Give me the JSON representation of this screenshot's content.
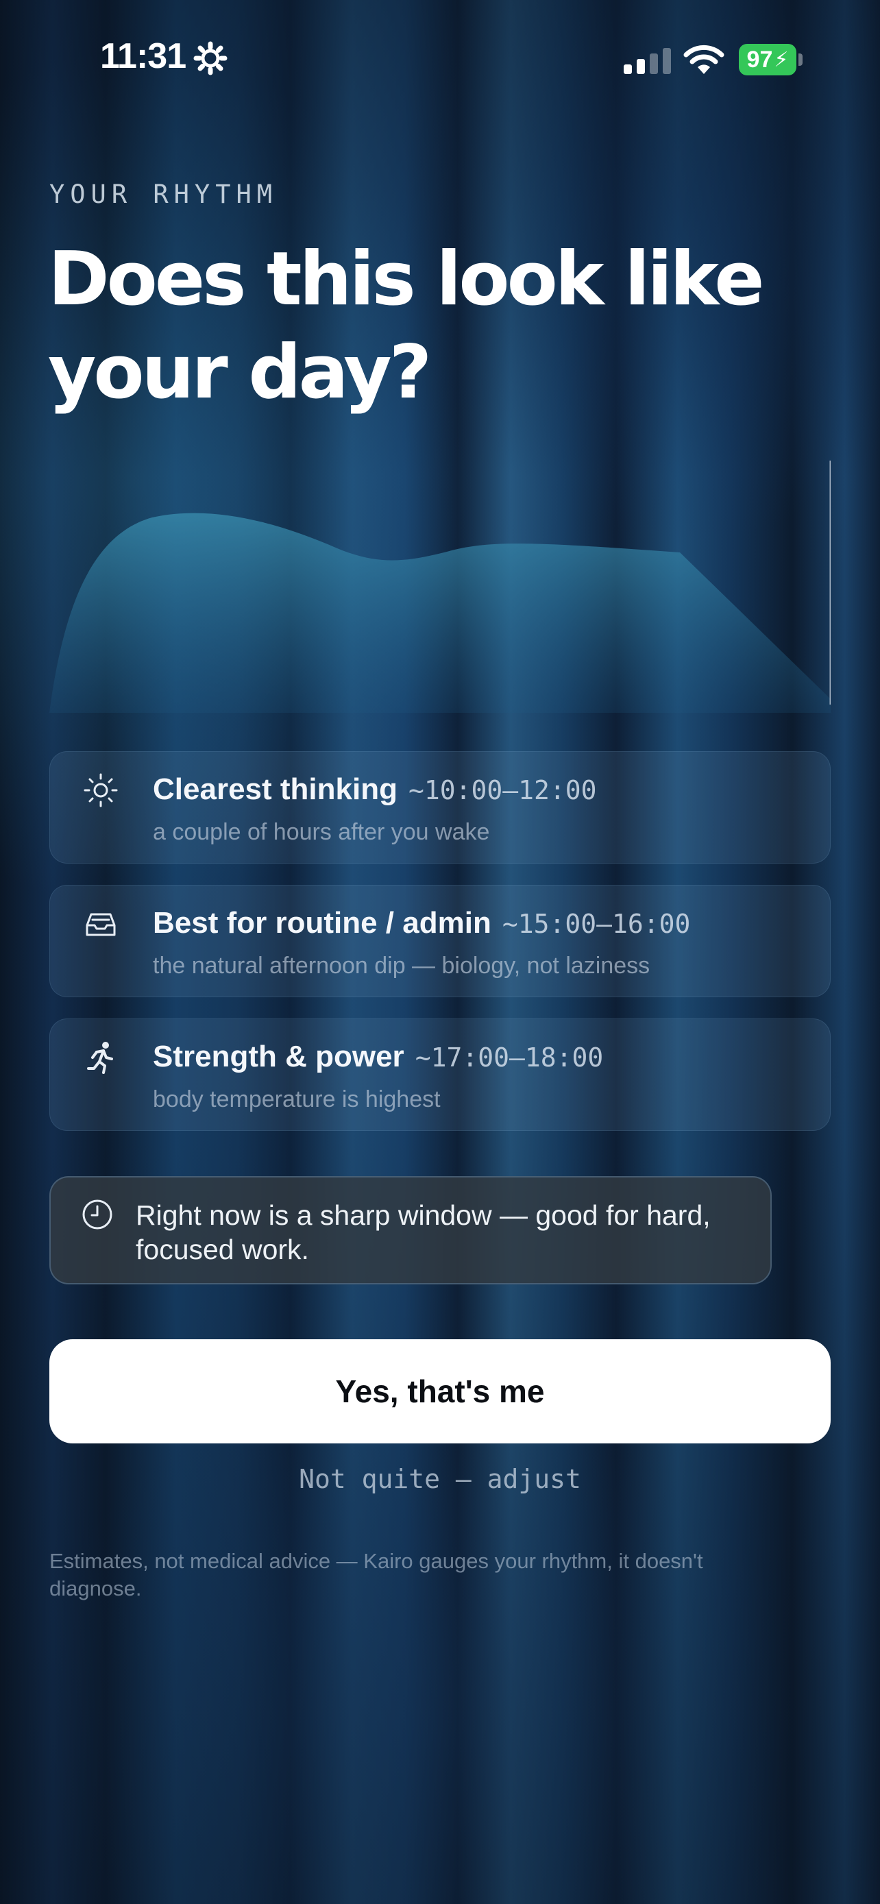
{
  "status_bar": {
    "time": "11:31",
    "battery": "97",
    "icons": [
      "gear-icon",
      "signal-icon",
      "wifi-icon",
      "battery-charging-icon"
    ]
  },
  "screen": {
    "eyebrow": "YOUR RHYTHM",
    "headline": "Does this look like your day?"
  },
  "rhythm_curve": {
    "fill_color": "#2f7c9a",
    "marker_color": "#cfd8e3"
  },
  "windows": [
    {
      "icon": "sun-icon",
      "title": "Clearest thinking",
      "time": "~10:00–12:00",
      "subtitle": "a couple of hours after you wake"
    },
    {
      "icon": "inbox-tray-icon",
      "title": "Best for routine / admin",
      "time": "~15:00–16:00",
      "subtitle": "the natural afternoon dip — biology, not laziness"
    },
    {
      "icon": "running-person-icon",
      "title": "Strength & power",
      "time": "~17:00–18:00",
      "subtitle": "body temperature is highest"
    }
  ],
  "now_note": {
    "icon": "clock-icon",
    "text": "Right now is a sharp window — good for hard, focused work."
  },
  "actions": {
    "confirm_label": "Yes, that's me",
    "adjust_label": "Not quite — adjust"
  },
  "disclaimer": "Estimates, not medical advice — Kairo gauges your rhythm, it doesn't diagnose."
}
